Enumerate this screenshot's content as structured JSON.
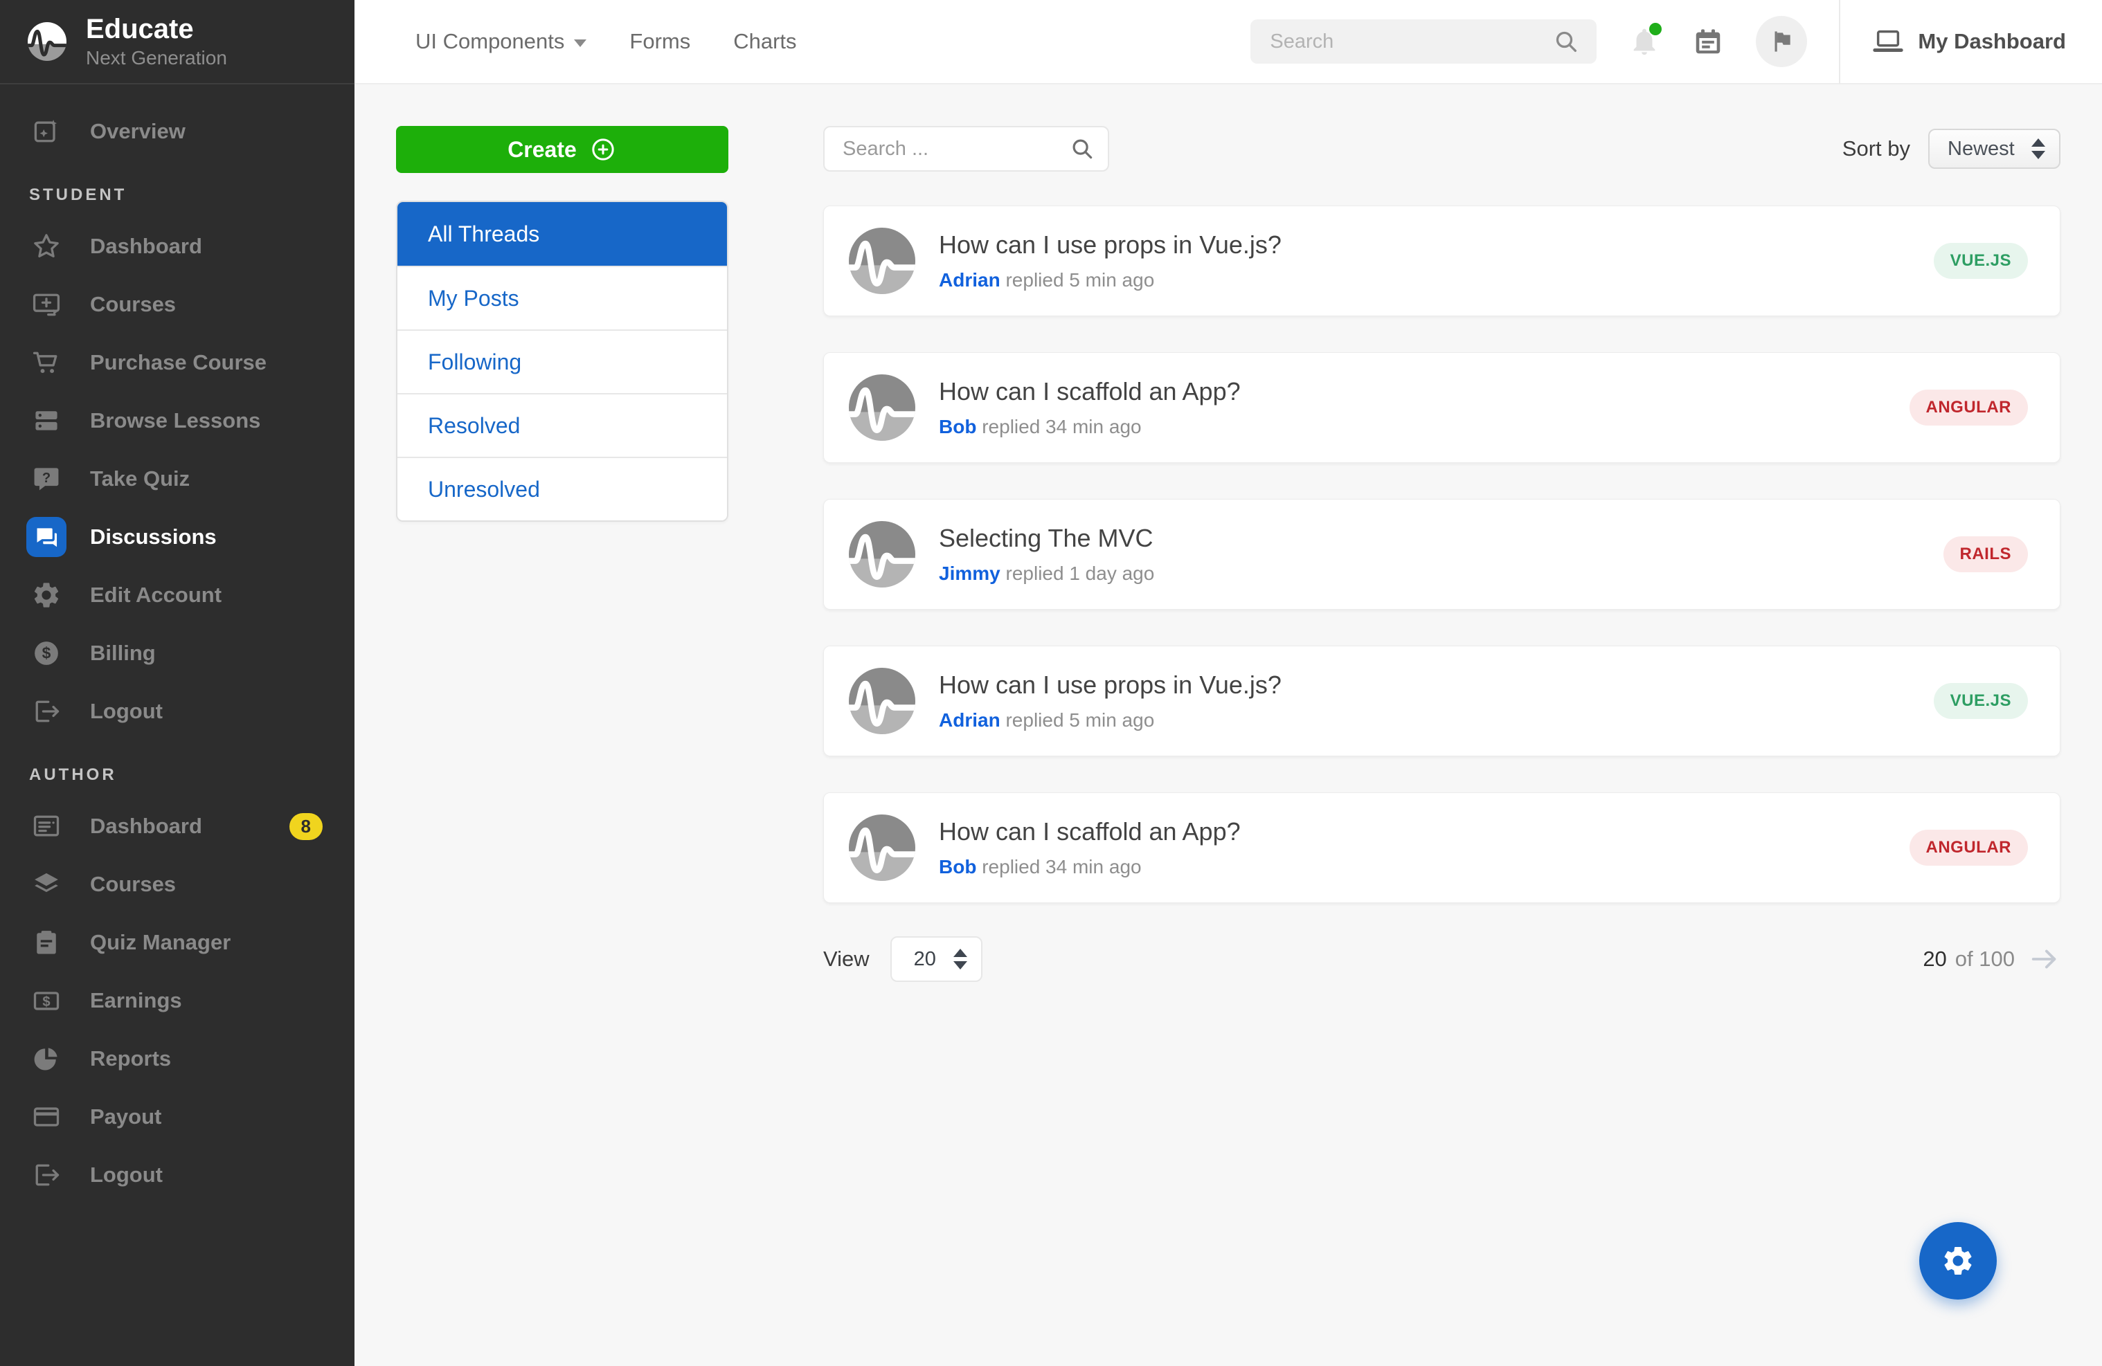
{
  "brand": {
    "name": "Educate",
    "tagline": "Next Generation"
  },
  "sidebar": {
    "sections": [
      {
        "items": [
          {
            "icon": "overview-icon",
            "label": "Overview"
          }
        ]
      },
      {
        "header": "STUDENT",
        "items": [
          {
            "icon": "star-icon",
            "label": "Dashboard"
          },
          {
            "icon": "courses-icon",
            "label": "Courses"
          },
          {
            "icon": "cart-icon",
            "label": "Purchase Course"
          },
          {
            "icon": "lessons-icon",
            "label": "Browse Lessons"
          },
          {
            "icon": "quiz-icon",
            "label": "Take Quiz"
          },
          {
            "icon": "discussions-icon",
            "label": "Discussions",
            "active": true
          },
          {
            "icon": "gear-icon",
            "label": "Edit Account"
          },
          {
            "icon": "billing-icon",
            "label": "Billing"
          },
          {
            "icon": "logout-icon",
            "label": "Logout"
          }
        ]
      },
      {
        "header": "AUTHOR",
        "items": [
          {
            "icon": "author-dashboard-icon",
            "label": "Dashboard",
            "badge": "8"
          },
          {
            "icon": "layers-icon",
            "label": "Courses"
          },
          {
            "icon": "clipboard-icon",
            "label": "Quiz Manager"
          },
          {
            "icon": "earnings-icon",
            "label": "Earnings"
          },
          {
            "icon": "reports-icon",
            "label": "Reports"
          },
          {
            "icon": "payout-icon",
            "label": "Payout"
          },
          {
            "icon": "logout-icon",
            "label": "Logout"
          }
        ]
      }
    ]
  },
  "topbar": {
    "nav_links": [
      {
        "label": "UI Components",
        "has_caret": true
      },
      {
        "label": "Forms",
        "has_caret": false
      },
      {
        "label": "Charts",
        "has_caret": false
      }
    ],
    "search_placeholder": "Search",
    "my_dashboard_label": "My Dashboard"
  },
  "discussions": {
    "create_label": "Create",
    "filters": [
      {
        "label": "All Threads",
        "active": true
      },
      {
        "label": "My Posts",
        "active": false
      },
      {
        "label": "Following",
        "active": false
      },
      {
        "label": "Resolved",
        "active": false
      },
      {
        "label": "Unresolved",
        "active": false
      }
    ],
    "search_placeholder": "Search ...",
    "sort_label": "Sort by",
    "sort_value": "Newest",
    "threads": [
      {
        "title": "How can I use props in Vue.js?",
        "author": "Adrian",
        "replied": "replied 5 min ago",
        "tag": "VUE.JS",
        "tag_color": "green"
      },
      {
        "title": "How can I scaffold an App?",
        "author": "Bob",
        "replied": "replied 34 min ago",
        "tag": "ANGULAR",
        "tag_color": "red"
      },
      {
        "title": "Selecting The MVC",
        "author": "Jimmy",
        "replied": "replied 1 day ago",
        "tag": "RAILS",
        "tag_color": "red"
      },
      {
        "title": "How can I use props in Vue.js?",
        "author": "Adrian",
        "replied": "replied 5 min ago",
        "tag": "VUE.JS",
        "tag_color": "green"
      },
      {
        "title": "How can I scaffold an App?",
        "author": "Bob",
        "replied": "replied 34 min ago",
        "tag": "ANGULAR",
        "tag_color": "red"
      }
    ],
    "view_label": "View",
    "view_value": "20",
    "pagination_current": "20",
    "pagination_of": "of 100"
  },
  "colors": {
    "sidebar_bg": "#2d2d2d",
    "primary_blue": "#1767c8",
    "create_green": "#1daf0a",
    "notification_green": "#1fae1a",
    "author_badge_yellow": "#f0d41e",
    "badge_green_text": "#2e9e63",
    "badge_green_bg": "#e7f5ed",
    "badge_red_text": "#c0272d",
    "badge_red_bg": "#fbe8e8",
    "content_bg": "#f7f7f7"
  }
}
